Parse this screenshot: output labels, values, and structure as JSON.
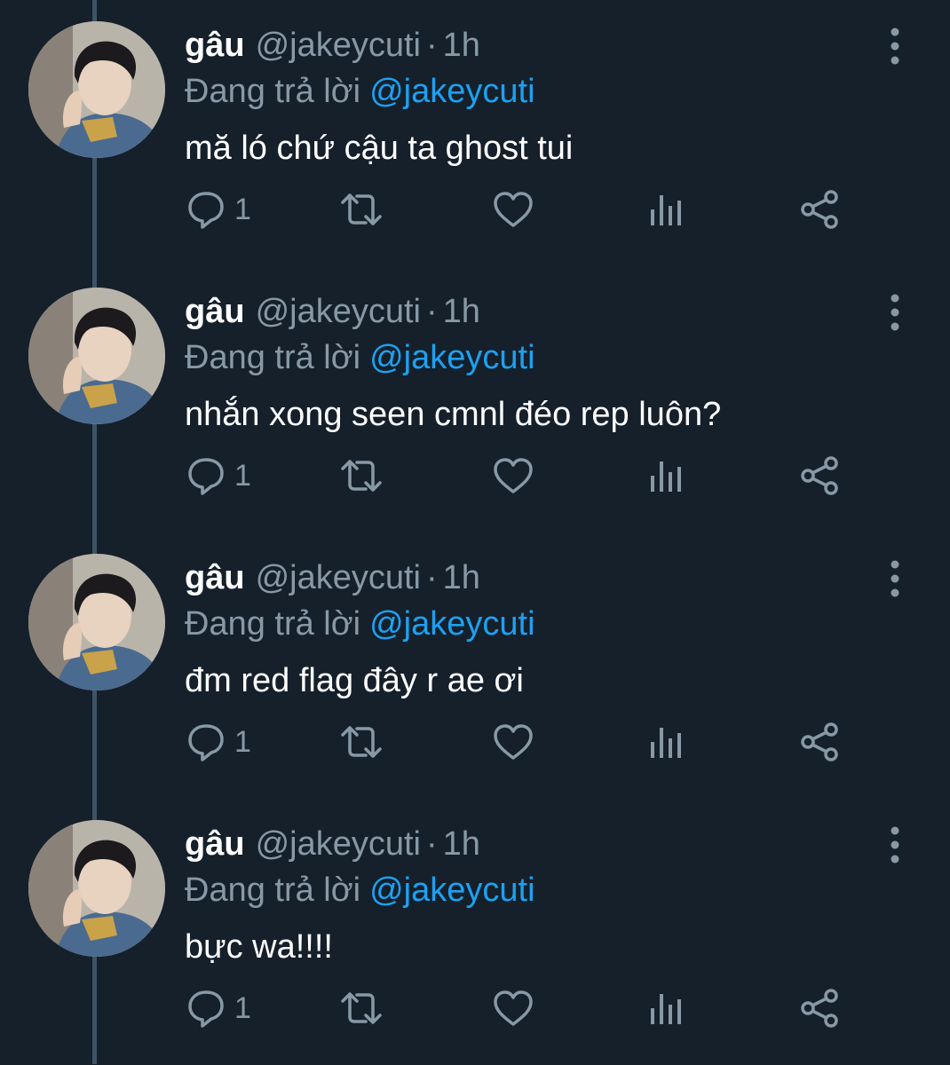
{
  "colors": {
    "background": "#15202b",
    "thread_line": "#3d5466",
    "secondary_text": "#8899a6",
    "link": "#1da1f2",
    "primary_text": "#ffffff"
  },
  "tweets": [
    {
      "name": "gâu",
      "handle": "@jakeycuti",
      "separator": "·",
      "time": "1h",
      "reply_prefix": "Đang trả lời",
      "reply_to": "@jakeycuti",
      "text": "mă ló chứ cậu ta ghost tui",
      "reply_count": "1",
      "icons": [
        "avatar-photo",
        "more-options-icon",
        "reply-icon",
        "retweet-icon",
        "like-icon",
        "analytics-icon",
        "share-icon"
      ]
    },
    {
      "name": "gâu",
      "handle": "@jakeycuti",
      "separator": "·",
      "time": "1h",
      "reply_prefix": "Đang trả lời",
      "reply_to": "@jakeycuti",
      "text": "nhắn xong seen cmnl đéo rep luôn?",
      "reply_count": "1",
      "icons": [
        "avatar-photo",
        "more-options-icon",
        "reply-icon",
        "retweet-icon",
        "like-icon",
        "analytics-icon",
        "share-icon"
      ]
    },
    {
      "name": "gâu",
      "handle": "@jakeycuti",
      "separator": "·",
      "time": "1h",
      "reply_prefix": "Đang trả lời",
      "reply_to": "@jakeycuti",
      "text": "đm red flag đây r ae ơi",
      "reply_count": "1",
      "icons": [
        "avatar-photo",
        "more-options-icon",
        "reply-icon",
        "retweet-icon",
        "like-icon",
        "analytics-icon",
        "share-icon"
      ]
    },
    {
      "name": "gâu",
      "handle": "@jakeycuti",
      "separator": "·",
      "time": "1h",
      "reply_prefix": "Đang trả lời",
      "reply_to": "@jakeycuti",
      "text": "bực wa!!!!",
      "reply_count": "1",
      "icons": [
        "avatar-photo",
        "more-options-icon",
        "reply-icon",
        "retweet-icon",
        "like-icon",
        "analytics-icon",
        "share-icon"
      ]
    }
  ]
}
